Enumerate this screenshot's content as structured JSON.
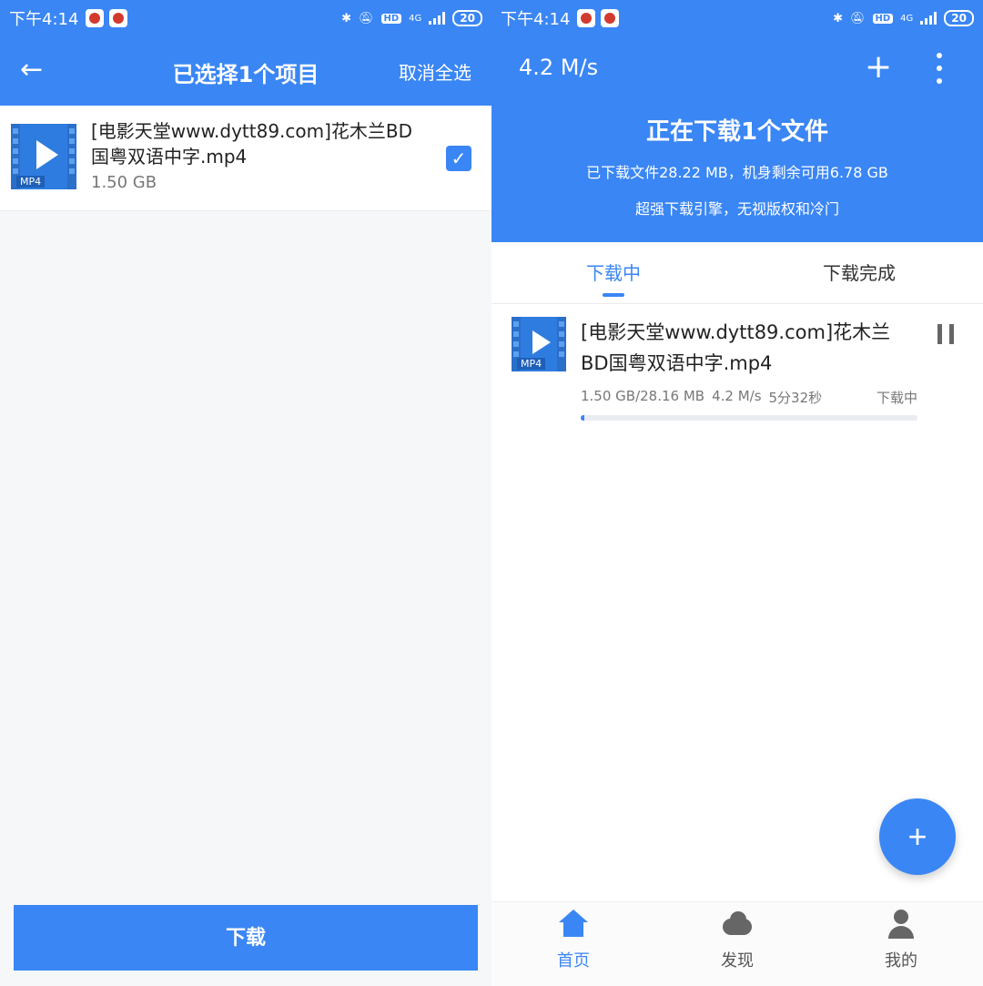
{
  "status_bar": {
    "time": "下午4:14",
    "network": "4G",
    "hd": "HD",
    "battery": "20"
  },
  "left": {
    "header": {
      "title": "已选择1个项目",
      "cancel_all": "取消全选"
    },
    "item": {
      "name": "[电影天堂www.dytt89.com]花木兰BD国粤双语中字.mp4",
      "size": "1.50 GB",
      "icon_tag": "MP4",
      "checked": true
    },
    "download_button": "下载"
  },
  "right": {
    "header": {
      "speed": "4.2 M/s",
      "title": "正在下载1个文件",
      "subtitle1": "已下载文件28.22 MB，机身剩余可用6.78 GB",
      "subtitle2": "超强下载引擎，无视版权和冷门"
    },
    "tabs": [
      {
        "label": "下载中",
        "active": true
      },
      {
        "label": "下载完成",
        "active": false
      }
    ],
    "download": {
      "name": "[电影天堂www.dytt89.com]花木兰BD国粤双语中字.mp4",
      "progress_text": "1.50 GB/28.16 MB",
      "speed": "4.2 M/s",
      "eta": "5分32秒",
      "status": "下载中",
      "progress_fraction": 0.01,
      "icon_tag": "MP4"
    },
    "bottom_nav": [
      {
        "label": "首页",
        "active": true,
        "icon": "home-icon"
      },
      {
        "label": "发现",
        "active": false,
        "icon": "cloud-icon"
      },
      {
        "label": "我的",
        "active": false,
        "icon": "user-icon"
      }
    ]
  },
  "colors": {
    "primary": "#3a86f4",
    "text_primary": "#222222",
    "text_secondary": "#777777"
  }
}
